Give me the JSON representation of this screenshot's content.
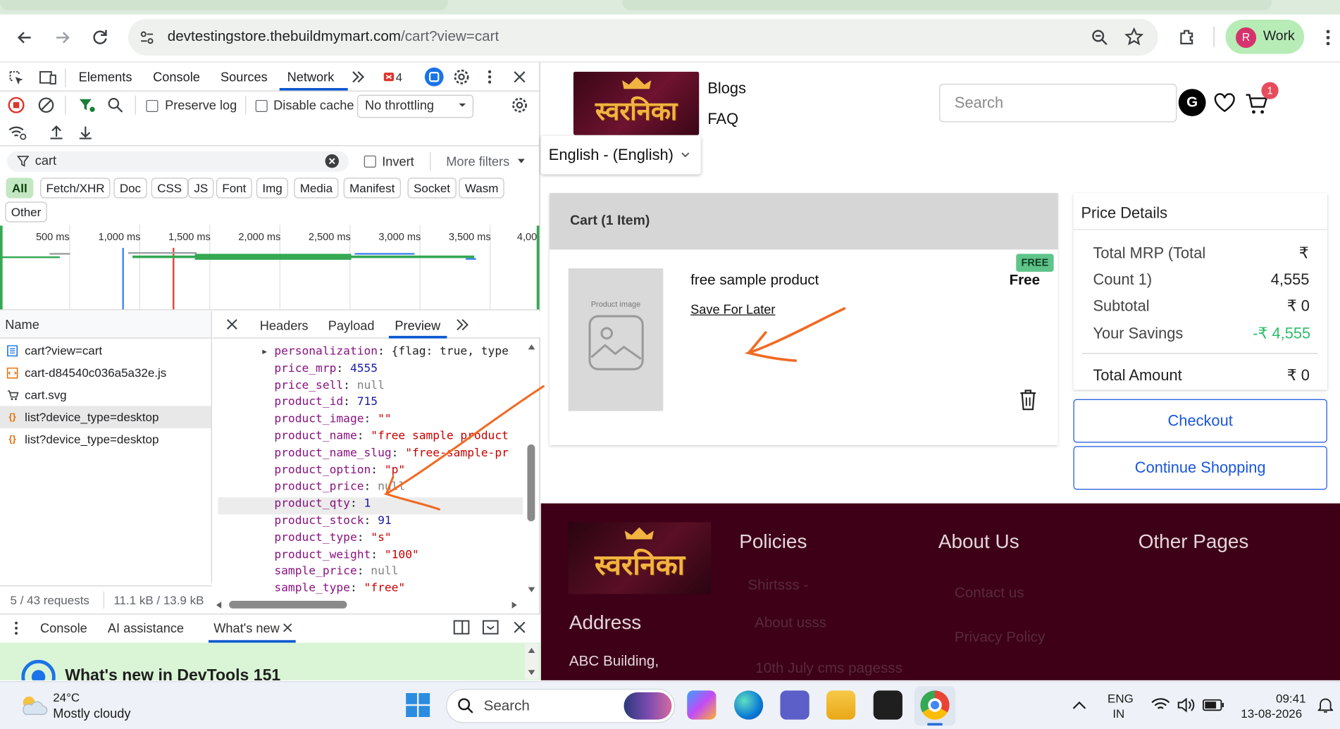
{
  "browser": {
    "url_domain": "devtestingstore.thebuildmymart.com",
    "url_path": "/cart?view=cart",
    "profile_initial": "R",
    "profile_label": "Work"
  },
  "devtools": {
    "tabs": [
      "Elements",
      "Console",
      "Sources",
      "Network"
    ],
    "issues_count": "4",
    "preserve_log": "Preserve log",
    "disable_cache": "Disable cache",
    "throttling": "No throttling",
    "filter_value": "cart",
    "invert": "Invert",
    "more_filters": "More filters",
    "chips": [
      "All",
      "Fetch/XHR",
      "Doc",
      "CSS",
      "JS",
      "Font",
      "Img",
      "Media",
      "Manifest",
      "Socket",
      "Wasm",
      "Other"
    ],
    "timeline_ticks": [
      "500 ms",
      "1,000 ms",
      "1,500 ms",
      "2,000 ms",
      "2,500 ms",
      "3,000 ms",
      "3,500 ms",
      "4,00"
    ],
    "name_header": "Name",
    "requests": [
      {
        "icon": "doc",
        "name": "cart?view=cart"
      },
      {
        "icon": "js",
        "name": "cart-d84540c036a5a32e.js"
      },
      {
        "icon": "svg",
        "name": "cart.svg"
      },
      {
        "icon": "fetch",
        "name": "list?device_type=desktop"
      },
      {
        "icon": "fetch",
        "name": "list?device_type=desktop"
      }
    ],
    "detail_tabs": [
      "Headers",
      "Payload",
      "Preview"
    ],
    "preview_lines": [
      {
        "key": "personalization",
        "value": "{flag: true, type:",
        "kind": "obj"
      },
      {
        "key": "price_mrp",
        "value": "4555",
        "kind": "num"
      },
      {
        "key": "price_sell",
        "value": "null",
        "kind": "null"
      },
      {
        "key": "product_id",
        "value": "715",
        "kind": "num"
      },
      {
        "key": "product_image",
        "value": "\"\"",
        "kind": "str"
      },
      {
        "key": "product_name",
        "value": "\"free sample product\"",
        "kind": "str"
      },
      {
        "key": "product_name_slug",
        "value": "\"free-sample-proc",
        "kind": "str"
      },
      {
        "key": "product_option",
        "value": "\"p\"",
        "kind": "str"
      },
      {
        "key": "product_price",
        "value": "null",
        "kind": "null"
      },
      {
        "key": "product_qty",
        "value": "1",
        "kind": "num"
      },
      {
        "key": "product_stock",
        "value": "91",
        "kind": "num"
      },
      {
        "key": "product_type",
        "value": "\"s\"",
        "kind": "str"
      },
      {
        "key": "product_weight",
        "value": "\"100\"",
        "kind": "str"
      },
      {
        "key": "sample_price",
        "value": "null",
        "kind": "null"
      },
      {
        "key": "sample_type",
        "value": "\"free\"",
        "kind": "str"
      }
    ],
    "status_requests": "5 / 43 requests",
    "status_size": "11.1 kB / 13.9 kB",
    "drawer_tabs": [
      "Console",
      "AI assistance",
      "What's new"
    ],
    "whats_new_title": "What's new in DevTools 151"
  },
  "site": {
    "logo_text": "स्वरनिका",
    "nav": [
      "Blogs",
      "FAQ"
    ],
    "search_placeholder": "Search",
    "account_initial": "G",
    "cart_count": "1",
    "language": "English - (English)",
    "cart_title": "Cart (1 Item)",
    "product_image_label": "Product image",
    "product_name": "free sample product",
    "free_badge": "FREE",
    "price_label": "Free",
    "save_for_later": "Save For Later",
    "price_details": {
      "title": "Price Details",
      "rows": [
        {
          "label": "Total MRP (Total",
          "value": "₹"
        },
        {
          "label": "Count 1)",
          "value": "4,555"
        },
        {
          "label": "Subtotal",
          "value": "₹ 0"
        },
        {
          "label": "Your Savings",
          "value": "-₹ 4,555"
        }
      ],
      "total_label": "Total Amount",
      "total_value": "₹ 0"
    },
    "checkout": "Checkout",
    "continue": "Continue Shopping",
    "footer": {
      "policies": "Policies",
      "about": "About Us",
      "other": "Other Pages",
      "address_title": "Address",
      "address_line": "ABC Building,",
      "policy_links": [
        "Shirtsss -",
        "About usss",
        "10th July cms pagesss"
      ],
      "about_links": [
        "Contact us",
        "Privacy Policy"
      ]
    },
    "colors": {
      "accent": "#1a56db",
      "savings": "#2ebd6b",
      "footer": "#3d0017",
      "badge": "#5fc48a"
    }
  },
  "taskbar": {
    "temp": "24°C",
    "weather": "Mostly cloudy",
    "search": "Search",
    "lang1": "ENG",
    "lang2": "IN",
    "time": "09:41",
    "date": "13-08-2026"
  }
}
